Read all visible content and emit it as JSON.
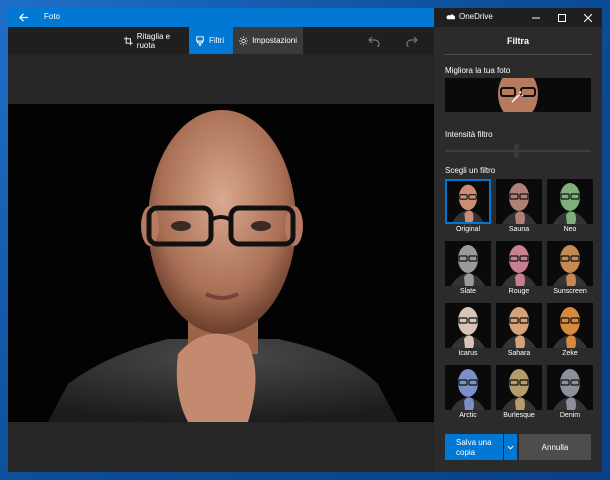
{
  "app": {
    "title": "Foto"
  },
  "toolbar": {
    "crop_label": "Ritaglia e ruota",
    "filters_label": "Filtri",
    "settings_label": "Impostazioni"
  },
  "panel": {
    "window_title": "OneDrive",
    "heading": "Filtra",
    "enhance_label": "Migliora la tua foto",
    "intensity_label": "Intensità filtro",
    "choose_label": "Scegli un filtro",
    "intensity_value": 0.5,
    "filters": [
      {
        "name": "Original",
        "tint": "#c98e74",
        "selected": true
      },
      {
        "name": "Sauna",
        "tint": "#b07f76"
      },
      {
        "name": "Neo",
        "tint": "#7fb07a"
      },
      {
        "name": "Slate",
        "tint": "#9a9a9a"
      },
      {
        "name": "Rouge",
        "tint": "#c68090"
      },
      {
        "name": "Sunscreen",
        "tint": "#c48a52"
      },
      {
        "name": "Icarus",
        "tint": "#d8c4b8"
      },
      {
        "name": "Sahara",
        "tint": "#d6a27a"
      },
      {
        "name": "Zeke",
        "tint": "#d6893f"
      },
      {
        "name": "Arctic",
        "tint": "#7b90c8"
      },
      {
        "name": "Burlesque",
        "tint": "#b59c6c"
      },
      {
        "name": "Denim",
        "tint": "#8d8f9a"
      }
    ],
    "save_label": "Salva una copia",
    "cancel_label": "Annulla"
  },
  "colors": {
    "accent": "#0078d4",
    "panel_bg": "#2b2b2b",
    "canvas_bg": "#262626"
  }
}
